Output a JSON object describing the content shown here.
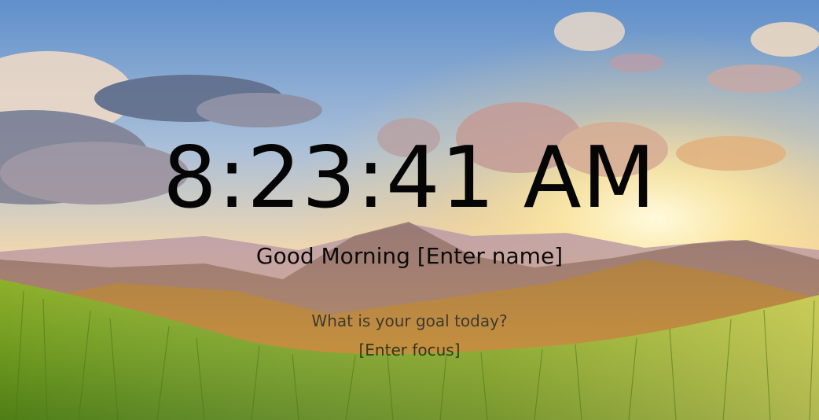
{
  "clock": {
    "time": "8:23:41 AM"
  },
  "greeting": {
    "prefix": "Good Morning ",
    "name": "[Enter name]"
  },
  "goal": {
    "question": "What is your goal today?",
    "focus": "[Enter focus]"
  },
  "background": {
    "scene": "sunrise-over-mountains-meadow",
    "sky_top": "#6f97c9",
    "sun": "#fff3b0",
    "grass": "#7fae2a"
  }
}
